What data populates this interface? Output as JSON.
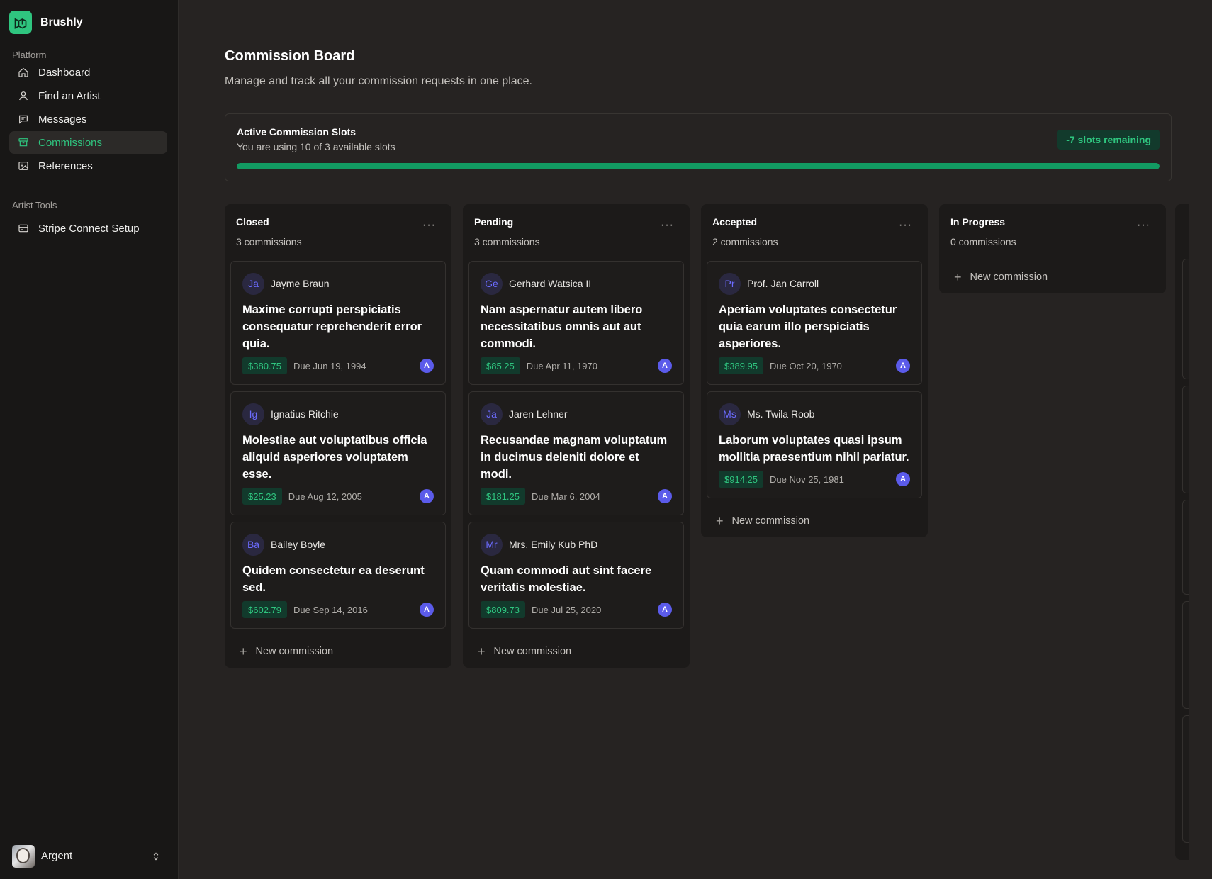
{
  "app": {
    "name": "Brushly"
  },
  "sidebar": {
    "groups": [
      {
        "label": "Platform"
      },
      {
        "label": "Artist Tools"
      }
    ],
    "platform_items": [
      {
        "label": "Dashboard",
        "icon": "home-icon"
      },
      {
        "label": "Find an Artist",
        "icon": "user-icon"
      },
      {
        "label": "Messages",
        "icon": "chat-icon"
      },
      {
        "label": "Commissions",
        "icon": "archive-icon",
        "active": true
      },
      {
        "label": "References",
        "icon": "image-icon"
      }
    ],
    "artist_items": [
      {
        "label": "Stripe Connect Setup",
        "icon": "credit-card-icon"
      }
    ],
    "user": {
      "name": "Argent"
    }
  },
  "page": {
    "title": "Commission Board",
    "subtitle": "Manage and track all your commission requests in one place."
  },
  "slots": {
    "title": "Active Commission Slots",
    "description": "You are using 10 of 3 available slots",
    "badge": "-7 slots remaining",
    "progress": 1.0
  },
  "columns": [
    {
      "title": "Closed",
      "count": "3 commissions",
      "new_label": "New commission",
      "cards": [
        {
          "initials": "Ja",
          "client": "Jayme Braun",
          "title": "Maxime corrupti perspiciatis consequatur reprehenderit error quia.",
          "price": "$380.75",
          "due": "Due Jun 19, 1994",
          "assignee": "A"
        },
        {
          "initials": "Ig",
          "client": "Ignatius Ritchie",
          "title": "Molestiae aut voluptatibus officia aliquid asperiores voluptatem esse.",
          "price": "$25.23",
          "due": "Due Aug 12, 2005",
          "assignee": "A"
        },
        {
          "initials": "Ba",
          "client": "Bailey Boyle",
          "title": "Quidem consectetur ea deserunt sed.",
          "price": "$602.79",
          "due": "Due Sep 14, 2016",
          "assignee": "A"
        }
      ]
    },
    {
      "title": "Pending",
      "count": "3 commissions",
      "new_label": "New commission",
      "cards": [
        {
          "initials": "Ge",
          "client": "Gerhard Watsica II",
          "title": "Nam aspernatur autem libero necessitatibus omnis aut aut commodi.",
          "price": "$85.25",
          "due": "Due Apr 11, 1970",
          "assignee": "A"
        },
        {
          "initials": "Ja",
          "client": "Jaren Lehner",
          "title": "Recusandae magnam voluptatum in ducimus deleniti dolore et modi.",
          "price": "$181.25",
          "due": "Due Mar 6, 2004",
          "assignee": "A"
        },
        {
          "initials": "Mr",
          "client": "Mrs. Emily Kub PhD",
          "title": "Quam commodi aut sint facere veritatis molestiae.",
          "price": "$809.73",
          "due": "Due Jul 25, 2020",
          "assignee": "A"
        }
      ]
    },
    {
      "title": "Accepted",
      "count": "2 commissions",
      "new_label": "New commission",
      "cards": [
        {
          "initials": "Pr",
          "client": "Prof. Jan Carroll",
          "title": "Aperiam voluptates consectetur quia earum illo perspiciatis asperiores.",
          "price": "$389.95",
          "due": "Due Oct 20, 1970",
          "assignee": "A"
        },
        {
          "initials": "Ms",
          "client": "Ms. Twila Roob",
          "title": "Laborum voluptates quasi ipsum mollitia praesentium nihil pariatur.",
          "price": "$914.25",
          "due": "Due Nov 25, 1981",
          "assignee": "A"
        }
      ]
    },
    {
      "title": "In Progress",
      "count": "0 commissions",
      "new_label": "New commission",
      "cards": []
    }
  ],
  "colors": {
    "accent": "#2fc57f",
    "assignee": "#5b5bea"
  }
}
